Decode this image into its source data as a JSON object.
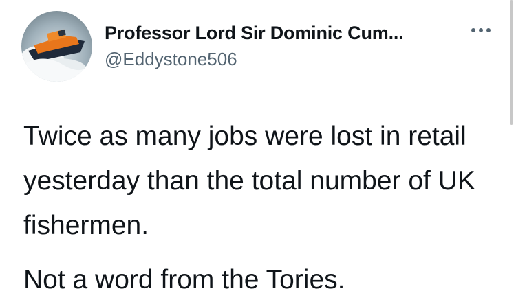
{
  "author": {
    "display_name": "Professor Lord Sir Dominic Cum...",
    "handle": "@Eddystone506",
    "avatar_icon": "lifeboat-avatar"
  },
  "menu": {
    "icon": "more-options-icon"
  },
  "tweet": {
    "paragraphs": [
      "Twice as many jobs were lost in retail yesterday than the total number of UK fishermen.",
      "Not a word from the Tories."
    ]
  },
  "colors": {
    "text": "#0f1419",
    "secondary": "#536471",
    "background": "#ffffff"
  }
}
